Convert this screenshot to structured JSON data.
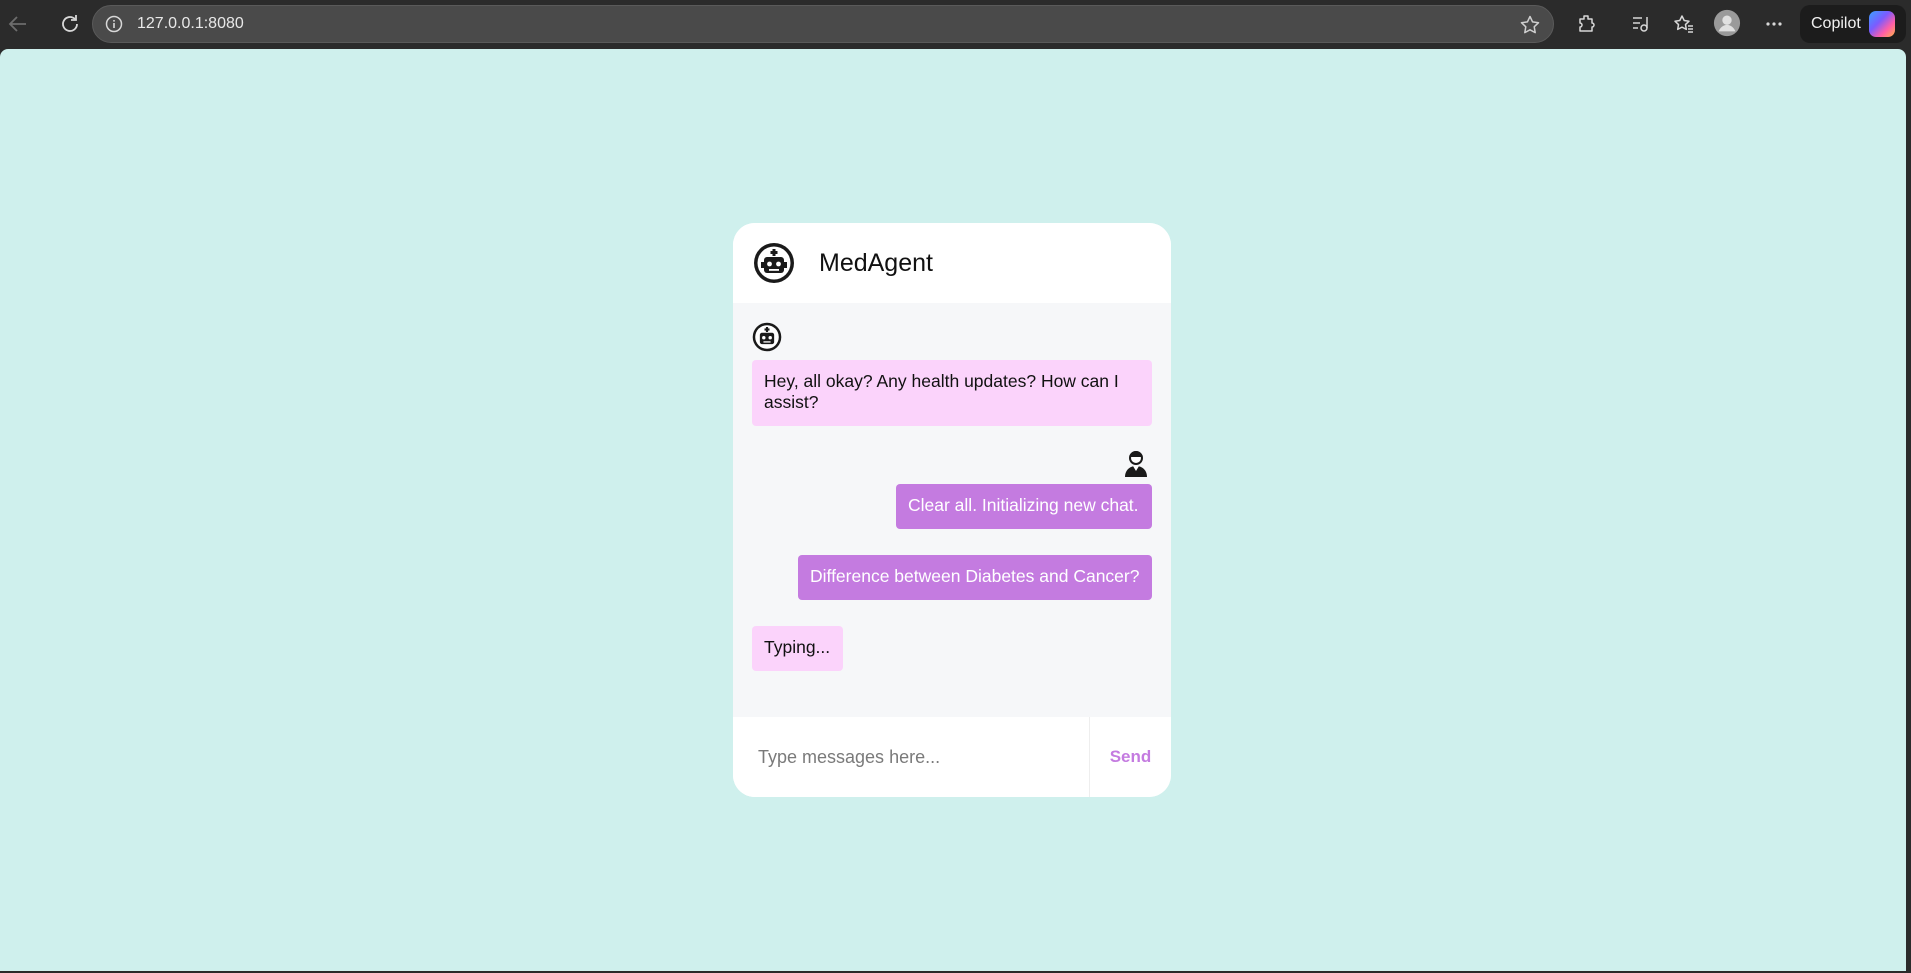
{
  "browser": {
    "url": "127.0.0.1:8080",
    "copilot_label": "Copilot"
  },
  "chat": {
    "title": "MedAgent",
    "input_placeholder": "Type messages here...",
    "send_label": "Send",
    "messages": [
      {
        "sender": "bot",
        "text": "Hey, all okay? Any health updates? How can I assist?"
      },
      {
        "sender": "user",
        "text": "Clear all. Initializing new chat."
      },
      {
        "sender": "user",
        "text": "Difference between Diabetes and Cancer?"
      },
      {
        "sender": "bot",
        "text": "Typing..."
      }
    ]
  },
  "colors": {
    "page_background": "#cff0ed",
    "bot_bubble": "#fbd3fb",
    "user_bubble": "#c47be0",
    "send_text": "#c47be0"
  }
}
